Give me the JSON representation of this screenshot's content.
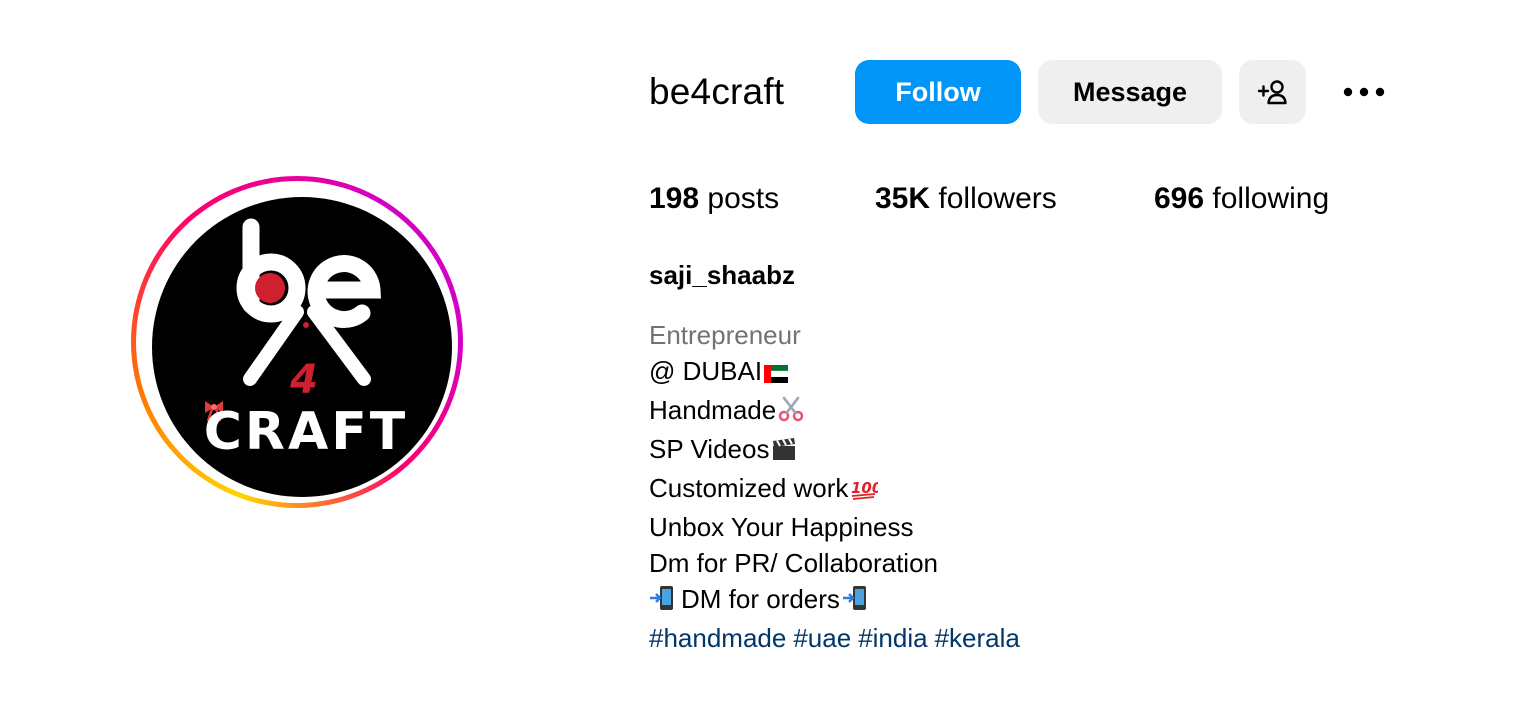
{
  "profile": {
    "username": "be4craft",
    "full_name": "saji_shaabz",
    "avatar_logo": {
      "top": "be",
      "middle": "4",
      "bottom": "CRAFT"
    }
  },
  "actions": {
    "follow_label": "Follow",
    "message_label": "Message",
    "add_user_icon": "person-add-icon",
    "more_icon": "ellipsis-icon"
  },
  "stats": {
    "posts_count": "198",
    "posts_label": "posts",
    "followers_count": "35K",
    "followers_label": "followers",
    "following_count": "696",
    "following_label": "following"
  },
  "bio": {
    "category": "Entrepreneur",
    "lines": [
      {
        "text": "@ DUBAI",
        "emoji": "uae-flag-icon"
      },
      {
        "text": "Handmade",
        "emoji": "scissors-icon"
      },
      {
        "text": "SP Videos",
        "emoji": "clapper-board-icon"
      },
      {
        "text": "Customized work",
        "emoji": "hundred-points-icon"
      },
      {
        "text": "Unbox Your Happiness"
      },
      {
        "text": "Dm for PR/ Collaboration"
      },
      {
        "text": "DM for orders",
        "emoji_before": "mobile-phone-arrow-icon",
        "emoji": "mobile-phone-arrow-icon"
      }
    ],
    "hashtags": [
      "#handmade",
      "#uae",
      "#india",
      "#kerala"
    ]
  },
  "colors": {
    "follow_button": "#0095f6",
    "secondary_button": "#efefef",
    "category_text": "#737373",
    "hashtag_text": "#00376b",
    "logo_accent": "#d0202f"
  }
}
